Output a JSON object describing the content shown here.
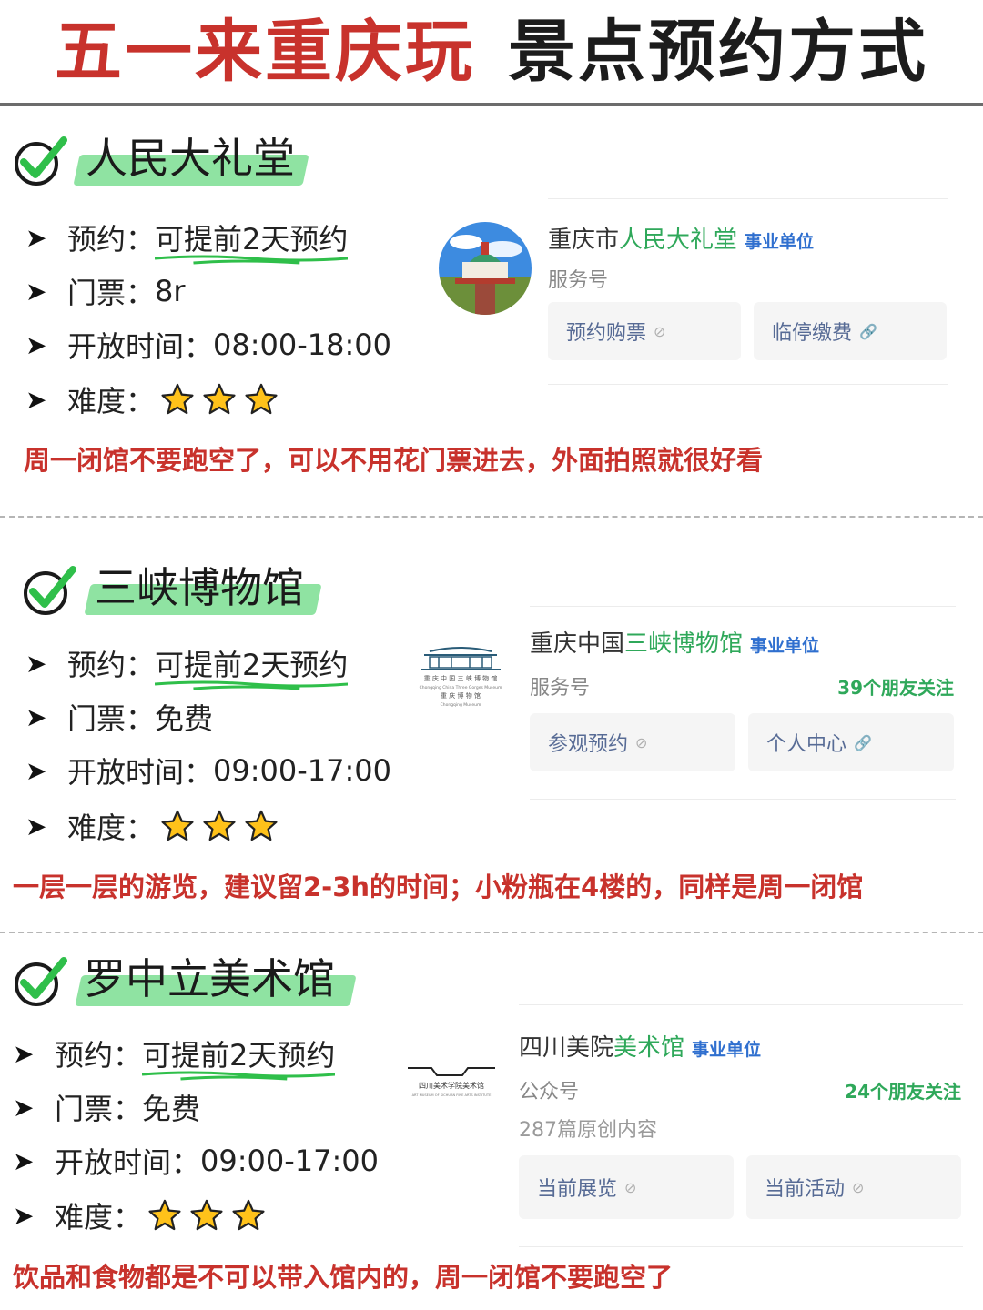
{
  "header": {
    "title_red": "五一来重庆玩",
    "title_black": "景点预约方式"
  },
  "colors": {
    "accent_red": "#c8322c",
    "highlight_green": "#8fe3a2",
    "link_green": "#2fa85a",
    "tag_blue": "#2f6fcf",
    "star_yellow": "#ffc21a"
  },
  "labels": {
    "reserve": "预约：",
    "ticket": "门票：",
    "hours": "开放时间：",
    "difficulty": "难度："
  },
  "sections": [
    {
      "title": "人民大礼堂",
      "reserve": "可提前2天预约",
      "ticket": "8r",
      "hours": "08:00-18:00",
      "difficulty_stars": 3,
      "note": "周一闭馆不要跑空了，可以不用花门票进去，外面拍照就很好看",
      "card": {
        "name_prefix": "重庆市",
        "name_hl": "人民大礼堂",
        "tag": "事业单位",
        "type": "服务号",
        "buttons": [
          "预约购票",
          "临停缴费"
        ]
      }
    },
    {
      "title": "三峡博物馆",
      "reserve": "可提前2天预约",
      "ticket": "免费",
      "hours": "09:00-17:00",
      "difficulty_stars": 3,
      "note": "一层一层的游览，建议留2-3h的时间；小粉瓶在4楼的，同样是周一闭馆",
      "card": {
        "name_prefix": "重庆中国",
        "name_hl": "三峡博物馆",
        "tag": "事业单位",
        "type": "服务号",
        "follow": "39个朋友关注",
        "logo_line1": "重 庆 中 国 三 峡 博 物 馆",
        "logo_line2": "Chongqing China Three Gorges Museum",
        "logo_line3": "重 庆 博 物 馆",
        "logo_line4": "Chongqing Museum",
        "buttons": [
          "参观预约",
          "个人中心"
        ]
      }
    },
    {
      "title": "罗中立美术馆",
      "reserve": "可提前2天预约",
      "ticket": "免费",
      "hours": "09:00-17:00",
      "difficulty_stars": 3,
      "note": "饮品和食物都是不可以带入馆内的，周一闭馆不要跑空了",
      "card": {
        "name_prefix": "四川美院",
        "name_hl": "美术馆",
        "tag": "事业单位",
        "type": "公众号",
        "follow": "24个朋友关注",
        "extra": "287篇原创内容",
        "logo_line1": "四川美术学院美术馆",
        "logo_line2": "ART MUSEUM OF SICHUAN FINE ARTS INSTITUTE",
        "buttons": [
          "当前展览",
          "当前活动"
        ]
      }
    }
  ]
}
